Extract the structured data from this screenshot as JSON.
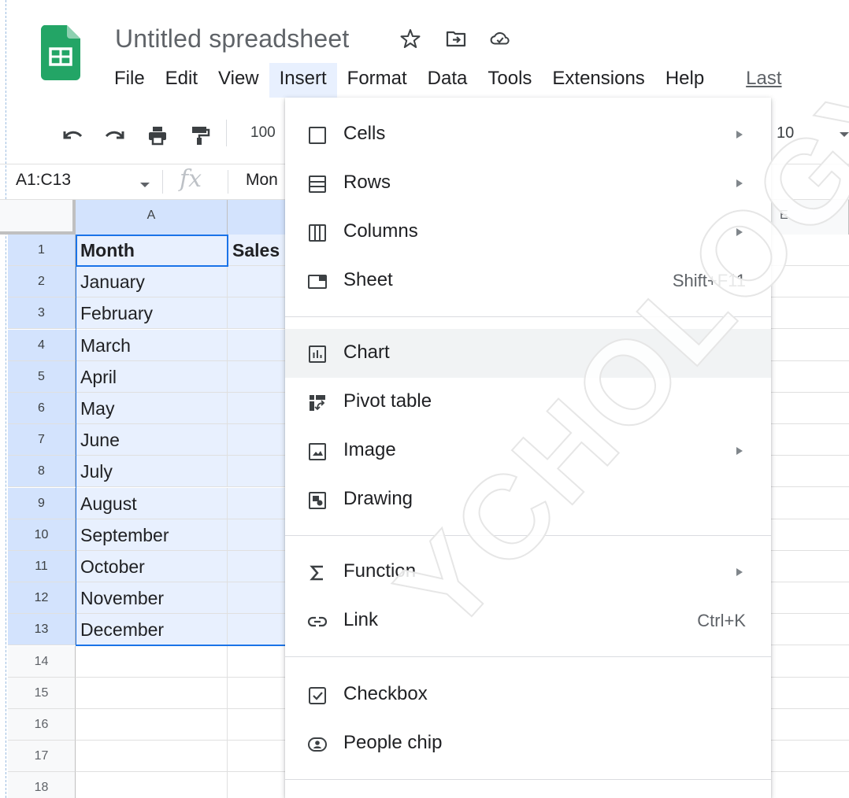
{
  "app": {
    "title": "Untitled spreadsheet"
  },
  "menubar": {
    "items": [
      "File",
      "Edit",
      "View",
      "Insert",
      "Format",
      "Data",
      "Tools",
      "Extensions",
      "Help"
    ],
    "last_edit": "Last"
  },
  "toolbar": {
    "zoom": "100",
    "font_size": "10"
  },
  "formula_bar": {
    "name_box": "A1:C13",
    "fx": "fx",
    "content": "Mon"
  },
  "grid": {
    "col_headers": [
      "A",
      "E"
    ],
    "rows": [
      {
        "num": "1",
        "a": "Month",
        "b": "Sales"
      },
      {
        "num": "2",
        "a": "January"
      },
      {
        "num": "3",
        "a": "February"
      },
      {
        "num": "4",
        "a": "March"
      },
      {
        "num": "5",
        "a": "April"
      },
      {
        "num": "6",
        "a": "May"
      },
      {
        "num": "7",
        "a": "June"
      },
      {
        "num": "8",
        "a": "July"
      },
      {
        "num": "9",
        "a": "August"
      },
      {
        "num": "10",
        "a": "September"
      },
      {
        "num": "11",
        "a": "October"
      },
      {
        "num": "12",
        "a": "November"
      },
      {
        "num": "13",
        "a": "December"
      },
      {
        "num": "14"
      },
      {
        "num": "15"
      },
      {
        "num": "16"
      },
      {
        "num": "17"
      },
      {
        "num": "18"
      }
    ]
  },
  "insert_menu": {
    "items": [
      {
        "label": "Cells",
        "icon": "cells-icon",
        "submenu": true
      },
      {
        "label": "Rows",
        "icon": "rows-icon",
        "submenu": true
      },
      {
        "label": "Columns",
        "icon": "columns-icon",
        "submenu": true
      },
      {
        "label": "Sheet",
        "icon": "sheet-icon",
        "shortcut": "Shift+F11"
      },
      {
        "label": "Chart",
        "icon": "chart-icon"
      },
      {
        "label": "Pivot table",
        "icon": "pivot-table-icon"
      },
      {
        "label": "Image",
        "icon": "image-icon",
        "submenu": true
      },
      {
        "label": "Drawing",
        "icon": "drawing-icon"
      },
      {
        "label": "Function",
        "icon": "sigma-icon",
        "submenu": true
      },
      {
        "label": "Link",
        "icon": "link-icon",
        "shortcut": "Ctrl+K"
      },
      {
        "label": "Checkbox",
        "icon": "checkbox-icon"
      },
      {
        "label": "People chip",
        "icon": "people-chip-icon"
      }
    ]
  },
  "watermark": "YCHOLOGY.CO",
  "colors": {
    "accent": "#1a73e8",
    "selection": "#e8f0fe",
    "sheets_green": "#0f9d58"
  }
}
